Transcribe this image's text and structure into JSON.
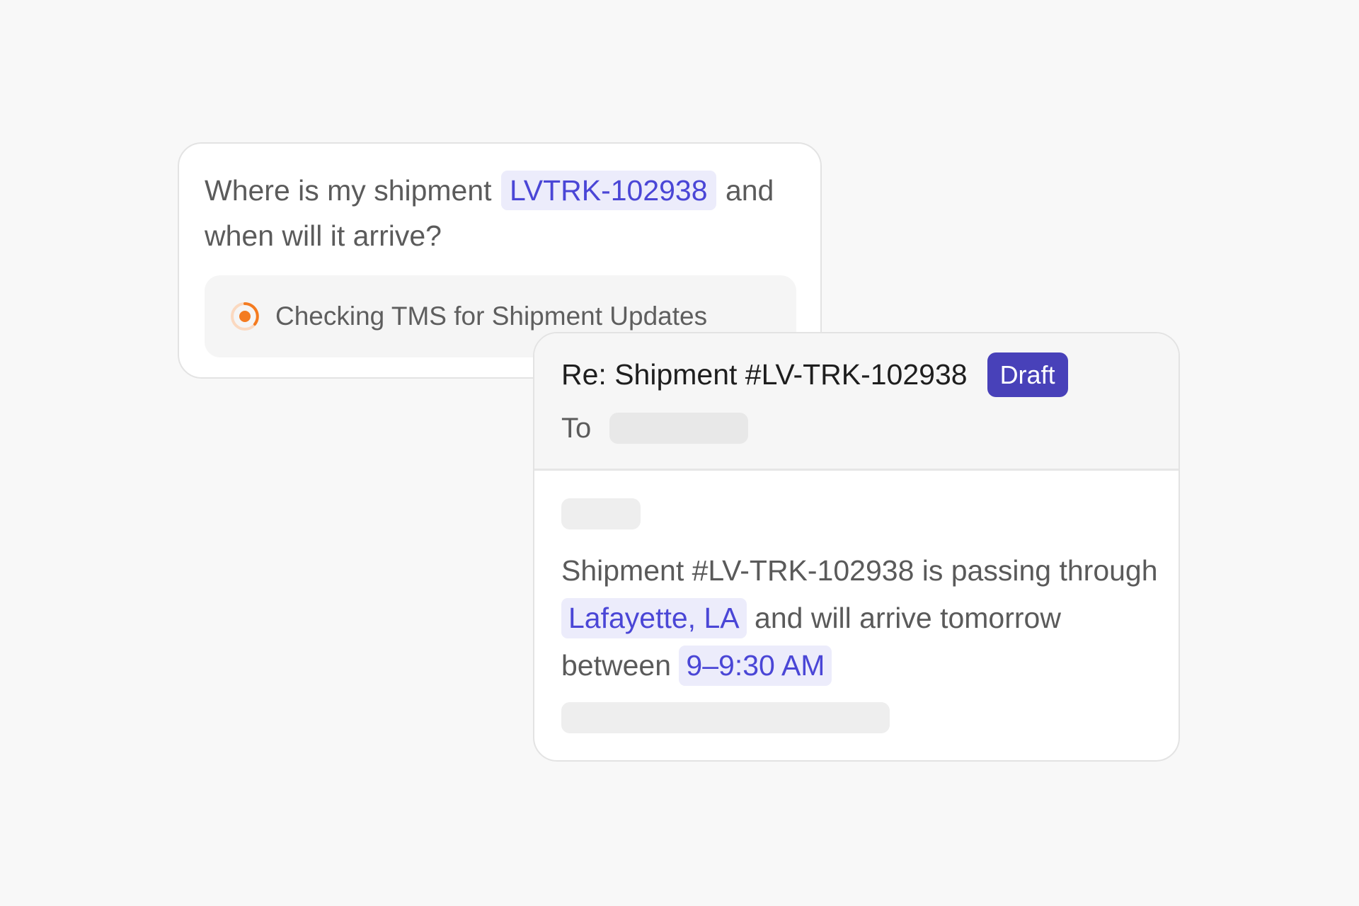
{
  "query_card": {
    "question_start": "Where is my shipment",
    "tracking_id": "LVTRK-102938",
    "question_end": "and when will it arrive?",
    "status_icon": "loading-spinner-icon",
    "status_text": "Checking TMS for Shipment Updates"
  },
  "email_draft": {
    "subject": "Re: Shipment #LV-TRK-102938",
    "badge": "Draft",
    "to_label": "To",
    "body": {
      "part1": "Shipment #LV-TRK-102938 is passing through",
      "location": "Lafayette, LA",
      "part2": "and will arrive tomorrow between",
      "time_window": "9–9:30 AM"
    }
  },
  "colors": {
    "background": "#f8f8f8",
    "highlight_bg": "#ececfb",
    "highlight_text": "#4a46d6",
    "badge_bg": "#4841b9",
    "spinner": "#f47b20"
  }
}
